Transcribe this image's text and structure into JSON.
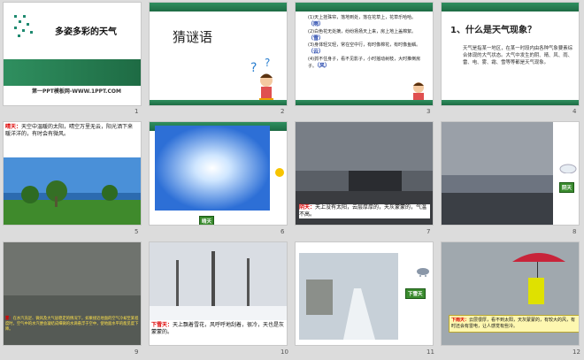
{
  "slides": [
    {
      "num": "1",
      "title": "多姿多彩的天气",
      "caption": "第一PPT模板网-WWW.1PPT.COM"
    },
    {
      "num": "2",
      "title": "猜谜语"
    },
    {
      "num": "3",
      "riddles": [
        {
          "text": "(1)天上挂珠帘，落地到处，落在花草上，花草乐哈哈。",
          "answer": "（雨）"
        },
        {
          "text": "(2)白色花无处摘，纷纷扬扬天上来，房上地上盖棉絮。",
          "answer": "（雪）"
        },
        {
          "text": "(3)身体轻又轻，常在空中行，有时像棉花，有时像鱼鳞。",
          "answer": "（云）"
        },
        {
          "text": "(4)抓不住身子，看不见影子，小时摇动树枝，大时推倒房子。",
          "answer": "（风）"
        }
      ]
    },
    {
      "num": "4",
      "title": "1、什么是天气现象？",
      "body": "天气是指某一地区，在某一时段内由各种气象要素综合体现的大气状态。大气中发生的阴、晴、风、雨、雷、电、雾、霜、雪等等都是天气现象。"
    },
    {
      "num": "5",
      "label": "晴天：",
      "text": "天空中温暖的太阳，晴空万里无云，阳光洒下来暖洋洋的，有时会有微风。"
    },
    {
      "num": "6",
      "tag": "晴天"
    },
    {
      "num": "7",
      "label": "阴天：",
      "text": "天上没有太阳，云层厚厚的，天灰蒙蒙的，气温不高。"
    },
    {
      "num": "8",
      "tag": "阴天"
    },
    {
      "num": "9",
      "label": "雾：",
      "text": "在水汽充足、微风及大气层稳定的情况下，如果接近地面的空气冷却至某程度时，空气中的水汽便会凝结成细微的水滴悬浮于空中，使地面水平的能见度下降。"
    },
    {
      "num": "10",
      "label": "下雪天：",
      "text": "天上飘着雪花，风呼呼地刮着，很冷，天也是灰蒙蒙的。"
    },
    {
      "num": "11",
      "tag": "下雪天"
    },
    {
      "num": "12",
      "label": "下雨天：",
      "text": "云层很厚，看不到太阳，天灰蒙蒙的，有较大的风，有时还会有雷电，让人感觉有些冷。"
    }
  ],
  "colors": {
    "green": "#2f8f5f",
    "red": "#d00000"
  }
}
